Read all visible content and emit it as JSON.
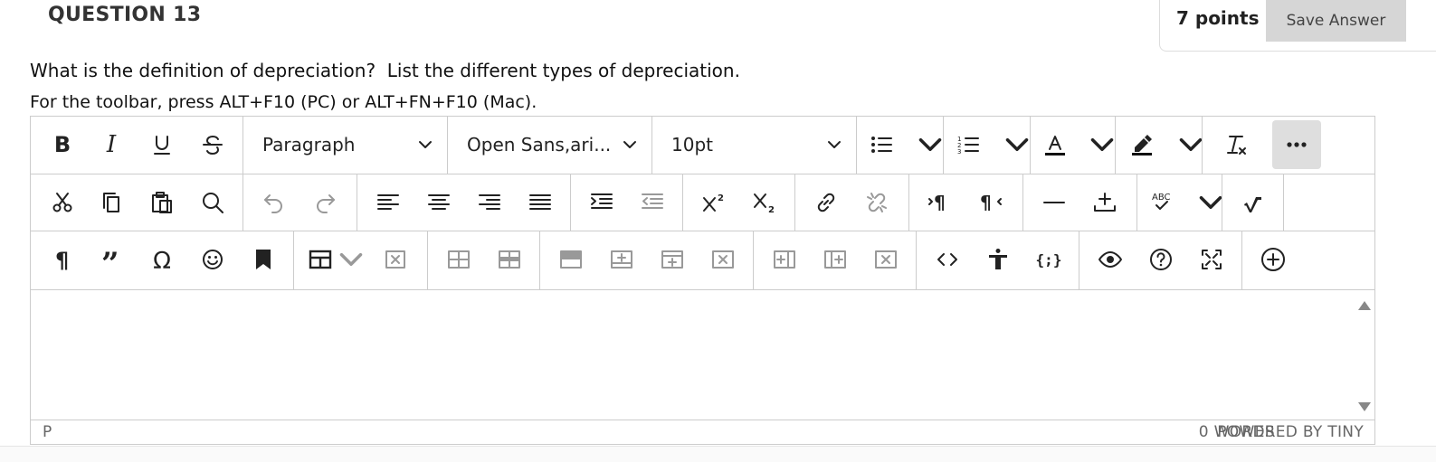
{
  "question": {
    "title": "QUESTION 13",
    "points": "7 points",
    "save_label": "Save Answer",
    "text": "What is the definition of depreciation?  List the different types of depreciation.",
    "toolbar_hint": "For the toolbar, press ALT+F10 (PC) or ALT+FN+F10 (Mac)."
  },
  "toolbar": {
    "block_format": "Paragraph",
    "font_family": "Open Sans,ari...",
    "font_size": "10pt",
    "spellcheck_badge": "ABC"
  },
  "statusbar": {
    "path": "P",
    "word_count": "0 WORDS",
    "powered_by": "POWERED BY TINY"
  }
}
